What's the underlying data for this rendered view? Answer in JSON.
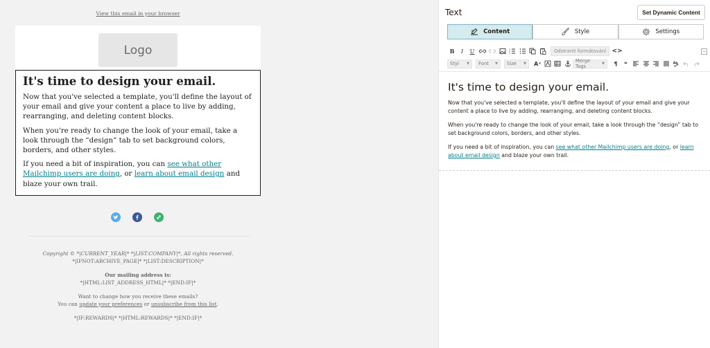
{
  "preview": {
    "view_in_browser": "View this email in your browser",
    "logo_text": "Logo",
    "heading": "It's time to design your email.",
    "p1": "Now that you've selected a template, you'll define the layout of your email and give your content a place to live by adding, rearranging, and deleting content blocks.",
    "p2": "When you're ready to change the look of your email, take a look through the “design” tab to set background colors, borders, and other styles.",
    "p3_pre": "If you need a bit of inspiration, you can ",
    "p3_link1": "see what other Mailchimp users are doing",
    "p3_mid": ", or ",
    "p3_link2": "learn about email design",
    "p3_post": " and blaze your own trail.",
    "social_icons": [
      "twitter-icon",
      "facebook-icon",
      "link-icon"
    ],
    "footer": {
      "copyright": "Copyright © *|CURRENT_YEAR|* *|LIST:COMPANY|*, All rights reserved.",
      "archive": "*|IFNOT:ARCHIVE_PAGE|* *|LIST:DESCRIPTION|*",
      "mailing_label": "Our mailing address is:",
      "address": "*|HTML:LIST_ADDRESS_HTML|* *|END:IF|*",
      "change_q": "Want to change how you receive these emails?",
      "can_pre": "You can ",
      "update_link": "update your preferences",
      "or": " or ",
      "unsub_link": "unsubscribe from this list",
      "period": ".",
      "rewards": "*|IF:REWARDS|* *|HTML:REWARDS|* *|END:IF|*"
    }
  },
  "panel": {
    "title": "Text",
    "dynamic_button": "Set Dynamic Content",
    "tabs": [
      {
        "label": "Content",
        "icon": "pencil-icon",
        "active": true
      },
      {
        "label": "Style",
        "icon": "paint-brush-icon",
        "active": false
      },
      {
        "label": "Settings",
        "icon": "gear-icon",
        "active": false
      }
    ],
    "toolbar": {
      "remove_format": "Odstranit formátování",
      "style_dd": "Styl",
      "font_dd": "Font",
      "size_dd": "Size",
      "merge_tags_dd": "Merge Tags"
    },
    "editor": {
      "heading": "It's time to design your email.",
      "p1": "Now that you've selected a template, you'll define the layout of your email and give your content a place to live by adding, rearranging, and deleting content blocks.",
      "p2": "When you're ready to change the look of your email, take a look through the “design” tab to set background colors, borders, and other styles.",
      "p3_pre": "If you need a bit of inspiration, you can ",
      "p3_link1": "see what other Mailchimp users are doing",
      "p3_mid": ", or ",
      "p3_link2": "learn about email design",
      "p3_post": " and blaze your own trail."
    }
  },
  "colors": {
    "link": "#007c89",
    "active_tab_bg": "#d4ebf0",
    "preview_bg": "#f2f2f2"
  }
}
